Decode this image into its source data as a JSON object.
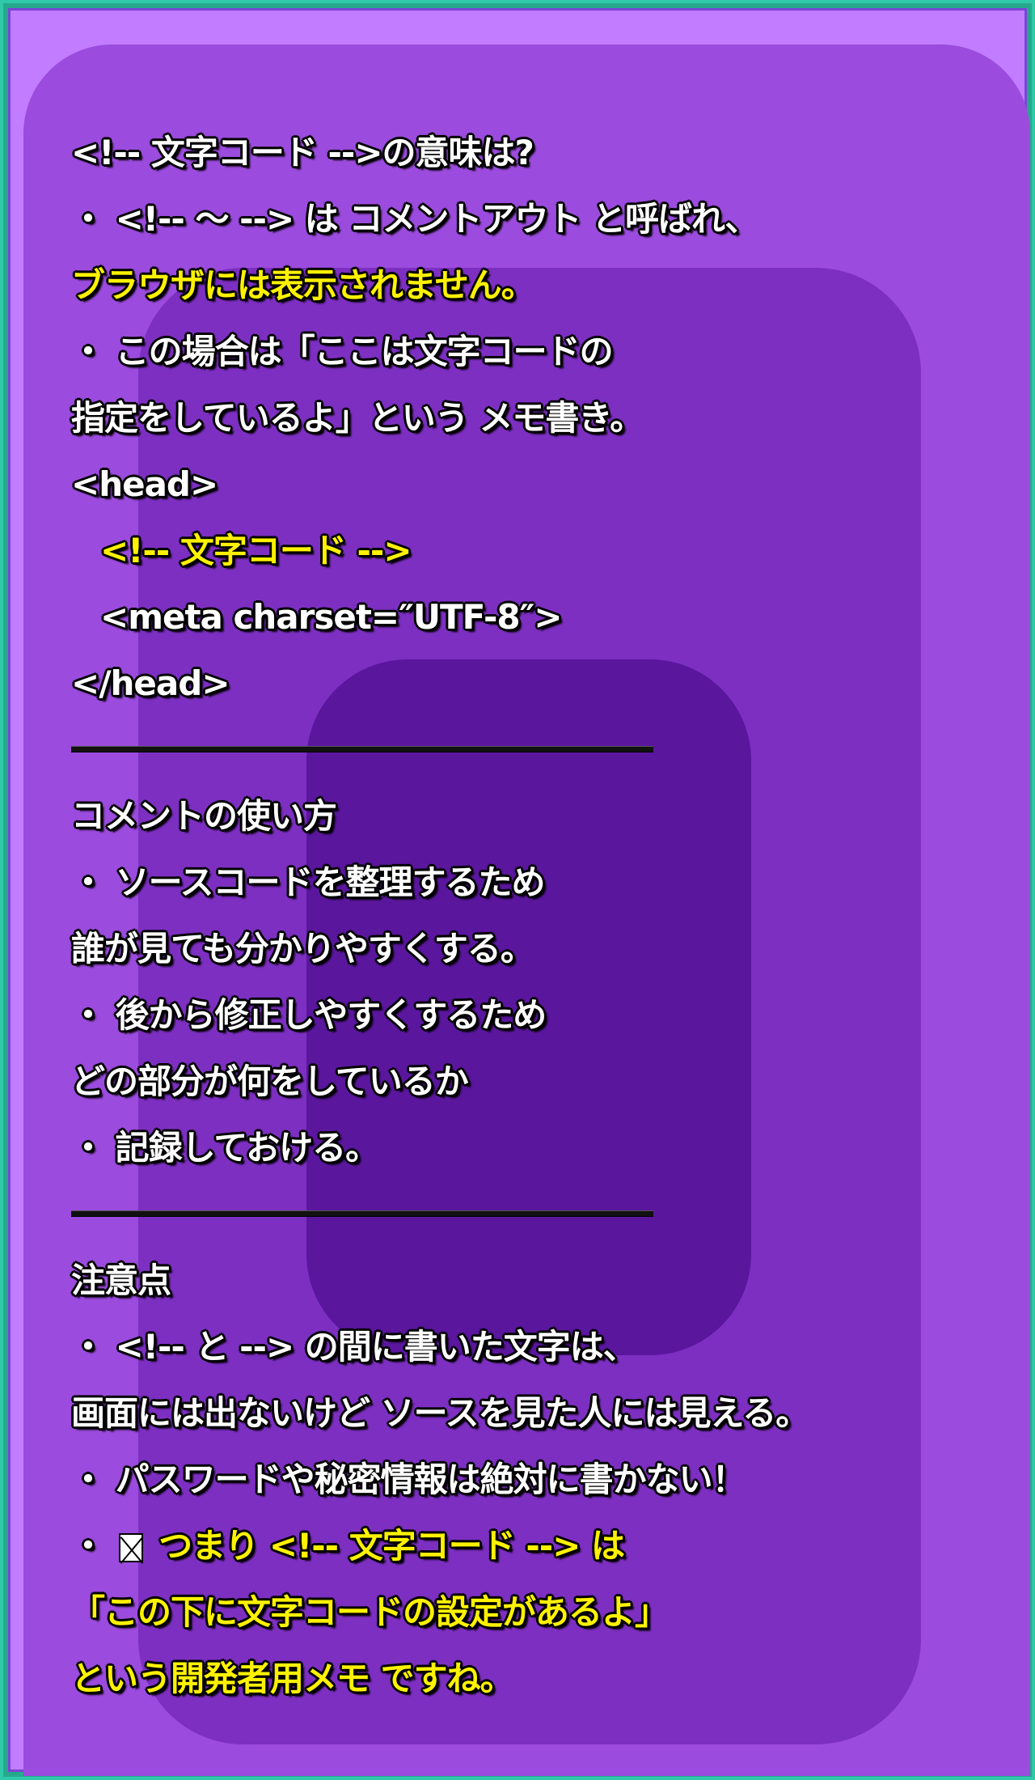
{
  "section1": {
    "title": "<!-- 文字コード -->の意味は?",
    "l1": "・ <!-- 〜 --> は コメントアウト と呼ばれ、",
    "l2": "ブラウザには表示されません。",
    "l3": "・ この場合は「ここは文字コードの",
    "l4": "指定をしているよ」という メモ書き。",
    "code1": "<head>",
    "code2": "<!-- 文字コード -->",
    "code3": "<meta charset=″UTF-8″>",
    "code4": "</head>"
  },
  "section2": {
    "title": "コメントの使い方",
    "l1": "・ ソースコードを整理するため",
    "l2": "誰が見ても分かりやすくする。",
    "l3": "・ 後から修正しやすくするため",
    "l4": "どの部分が何をしているか",
    "l5": "・ 記録しておける。"
  },
  "section3": {
    "title": "注意点",
    "l1": "・ <!-- と --> の間に書いた文字は、",
    "l2": "画面には出ないけど ソースを見た人には見える。",
    "l3": "・ パスワードや秘密情報は絶対に書かない！",
    "l4_bullet": "・",
    "l4_icon": "box-x-icon",
    "l4": "つまり <!-- 文字コード --> は",
    "l5": "「この下に文字コードの設定があるよ」",
    "l6": "という開発者用メモ ですね。"
  },
  "colors": {
    "text": "#ffffff",
    "highlight": "#fff200",
    "panel": "#9b4bdd",
    "border": "#2fc9a9"
  }
}
